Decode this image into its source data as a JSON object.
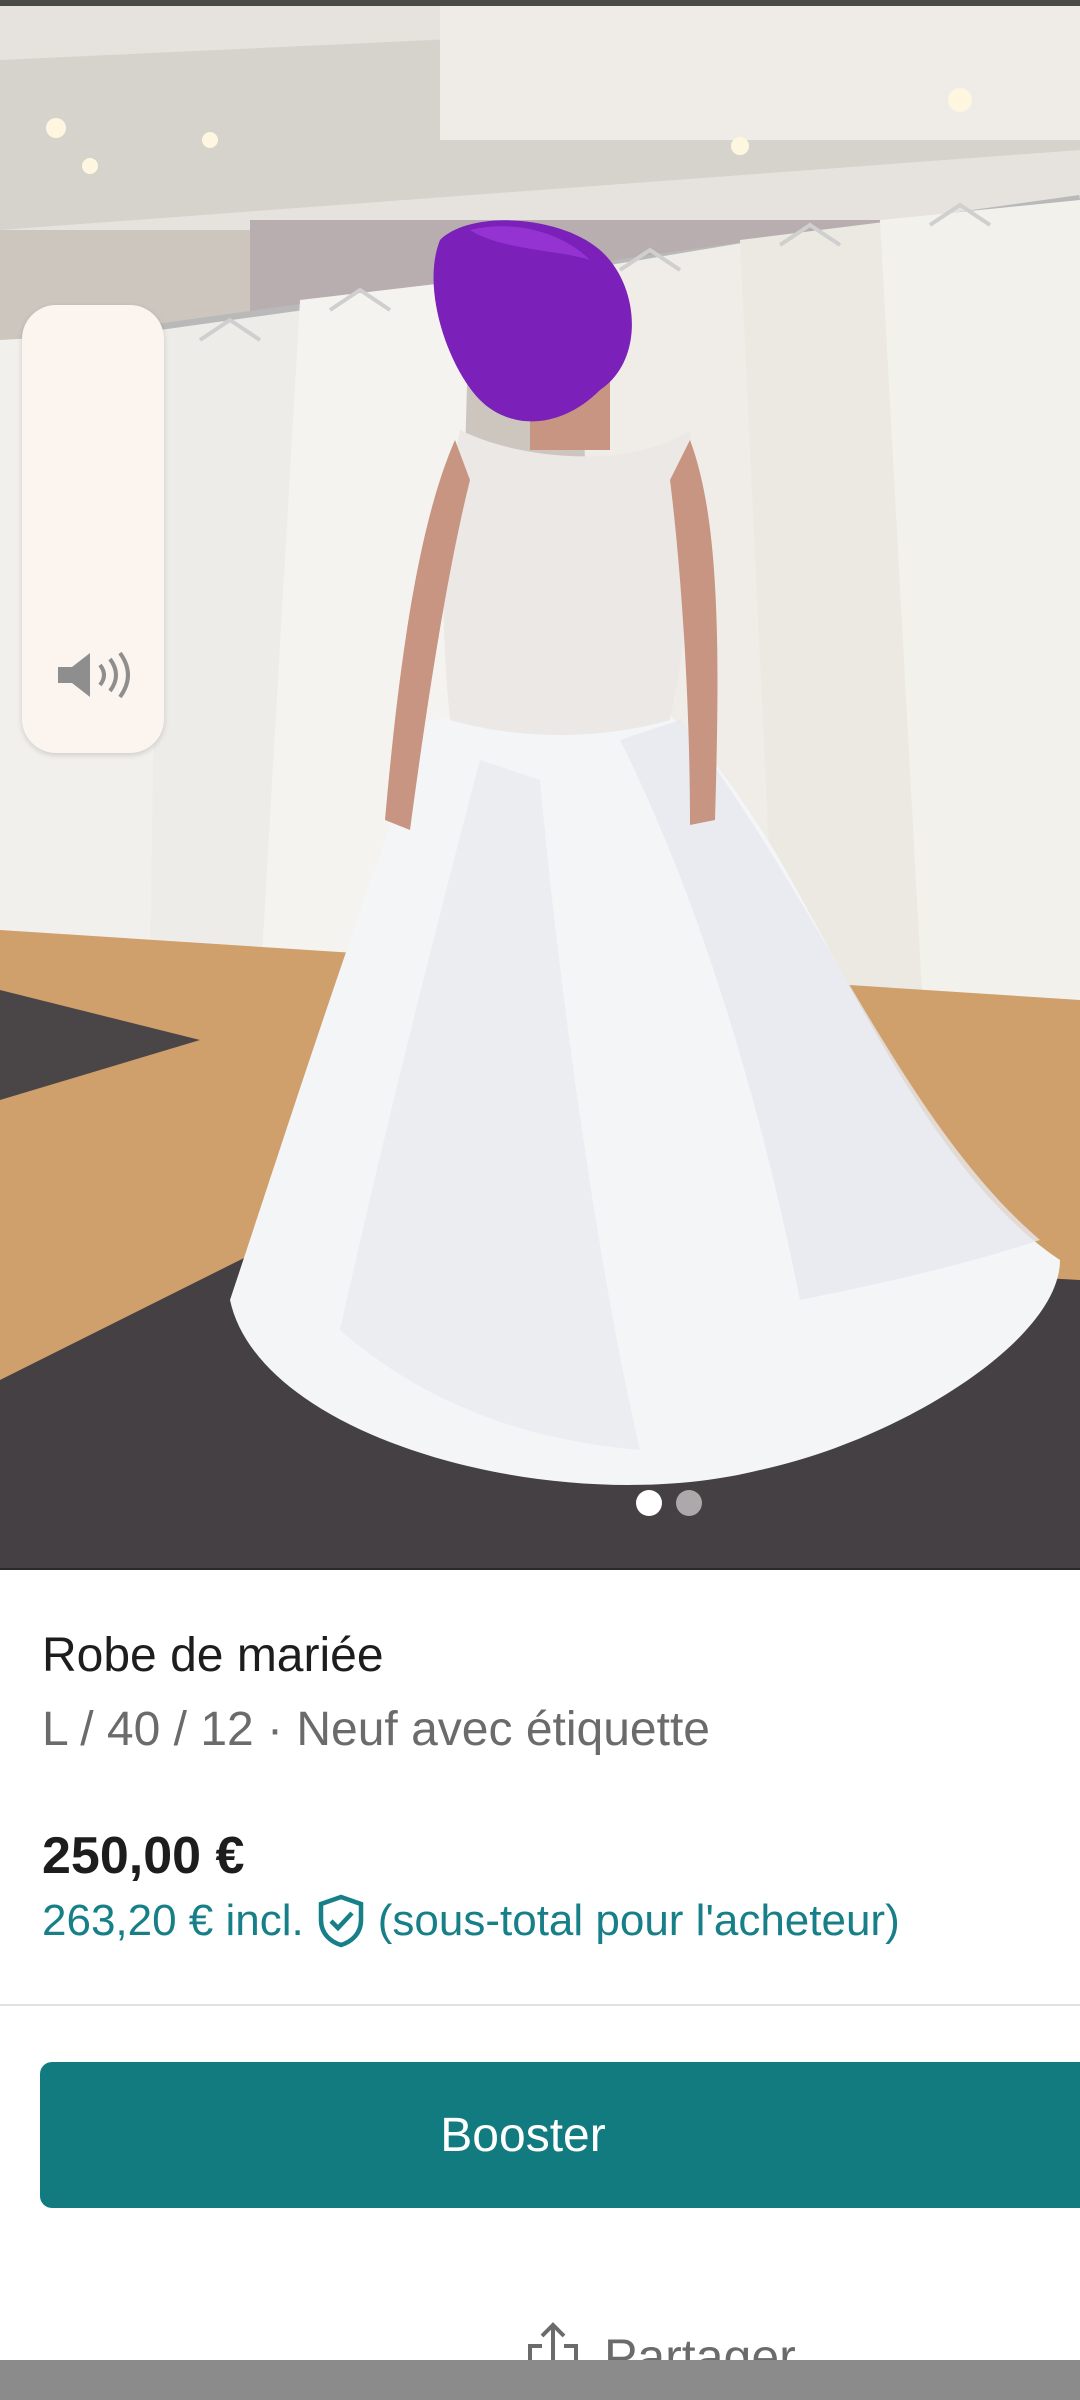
{
  "product": {
    "title": "Robe de mariée",
    "details": "L / 40 / 12 · Neuf avec étiquette",
    "price": "250,00 €",
    "price_incl": "263,20 € incl.",
    "price_incl_note": "(sous-total pour l'acheteur)"
  },
  "gallery": {
    "image_count": 2,
    "active_index": 0
  },
  "actions": {
    "booster_label": "Booster",
    "share_label": "Partager"
  },
  "icons": {
    "volume": "speaker-icon",
    "buyer_protection": "shield-check-icon",
    "share": "share-icon"
  },
  "colors": {
    "accent": "#127b80",
    "accent_text": "#177f88",
    "text_primary": "#1d1d1d",
    "text_secondary": "#6b6b6b"
  }
}
